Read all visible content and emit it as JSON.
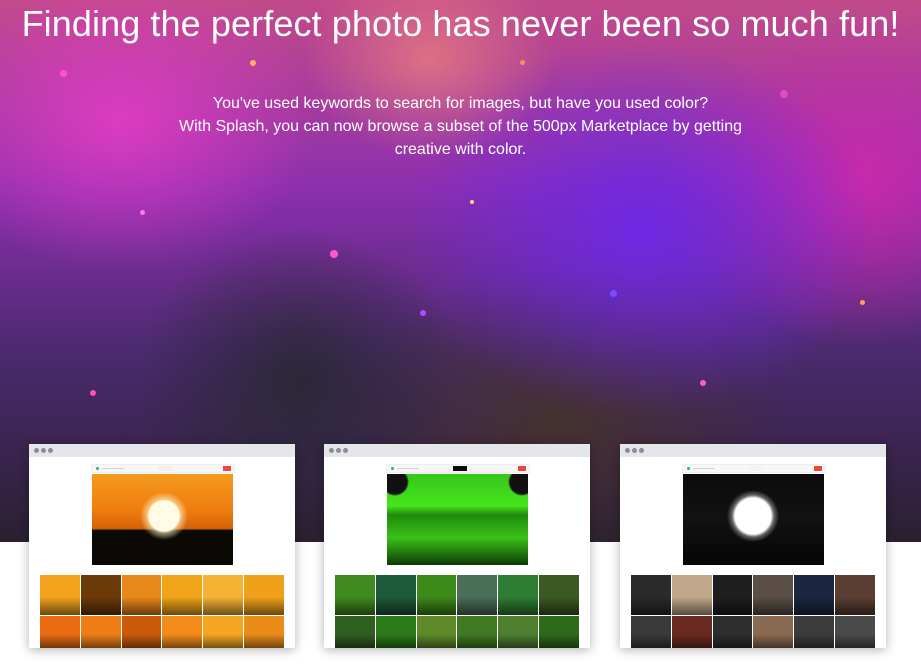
{
  "hero": {
    "title": "Finding the perfect photo has never been so much fun!",
    "description_lines": [
      "You've used keywords to search for images, but have you used color?",
      "With Splash, you can now browse a subset of the 500px Marketplace by getting",
      "creative with color."
    ]
  },
  "colors": {
    "hero_purple": "#8c2fae",
    "hero_magenta": "#e63cc8",
    "title_text": "#ffffff",
    "chrome_bar": "#e4e6e9",
    "mini_button": "#e84b3c"
  },
  "showcase_cards": [
    {
      "theme": "orange sunset",
      "swatch_color": "#f6f1e8",
      "logo_color": "#2fb36b",
      "thumbnails": [
        "#f2a21c",
        "#6b3a08",
        "#e8871a",
        "#f0a418",
        "#f6b233",
        "#f0a11a",
        "#e96c12",
        "#f07e16",
        "#c85a0a",
        "#f28b1a",
        "#f4a61f",
        "#e98c18"
      ]
    },
    {
      "theme": "green",
      "swatch_color": "#0a0a0a",
      "logo_color": "#2fb36b",
      "thumbnails": [
        "#3f8a1c",
        "#1d5a3a",
        "#3c8a18",
        "#4a6e58",
        "#2e7d33",
        "#3a5a22",
        "#2f5f1e",
        "#2a7a1a",
        "#5e8a2a",
        "#3f7a22",
        "#4d7f2e",
        "#2d6a1a"
      ]
    },
    {
      "theme": "black and white",
      "swatch_color": "#f3f3f3",
      "logo_color": "#2fb36b",
      "thumbnails": [
        "#2a2a2a",
        "#c2a88a",
        "#1e1e1e",
        "#5a4e46",
        "#1b2740",
        "#5a3e32",
        "#3a3a3a",
        "#6a2a20",
        "#2e2e2e",
        "#8a6a50",
        "#3c3c3c",
        "#4a4a4a"
      ]
    }
  ]
}
